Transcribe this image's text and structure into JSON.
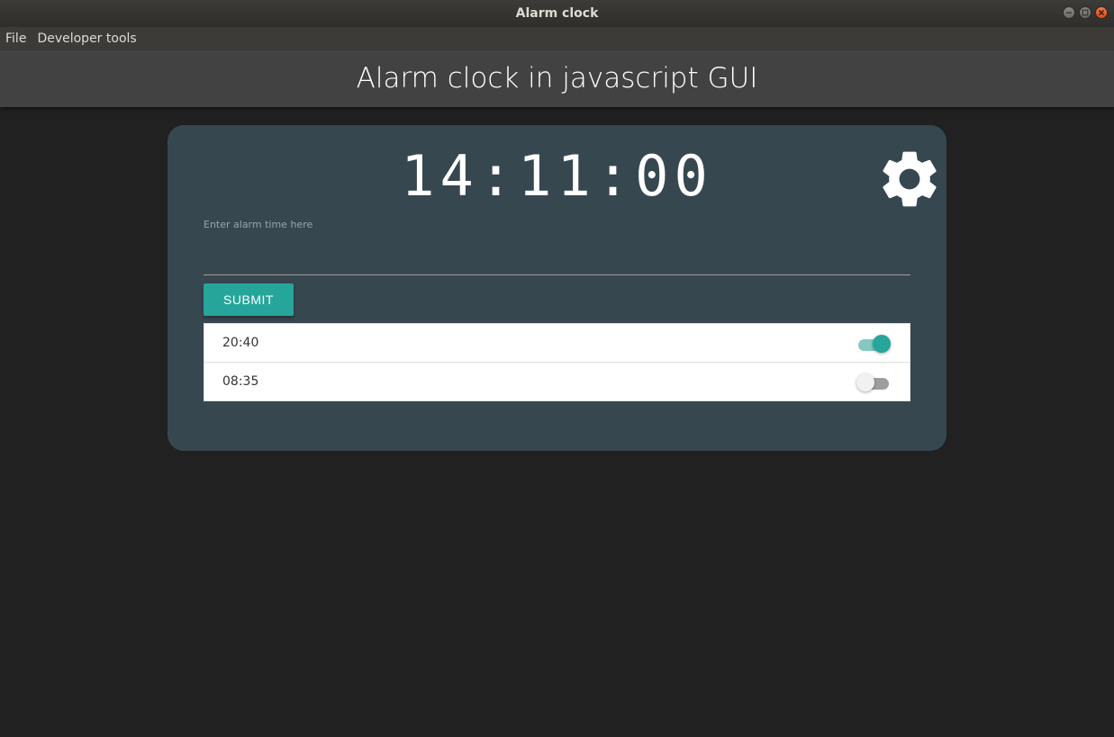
{
  "window": {
    "title": "Alarm clock",
    "buttons": [
      "minimize-icon",
      "maximize-icon",
      "close-icon"
    ]
  },
  "menu": {
    "items": [
      {
        "label": "File"
      },
      {
        "label": "Developer tools"
      }
    ]
  },
  "header": {
    "title": "Alarm clock in javascript GUI"
  },
  "clock": {
    "time": "14:11:00"
  },
  "settings": {
    "icon": "gear-icon"
  },
  "alarm_form": {
    "label": "Enter alarm time here",
    "value": "",
    "submit_label": "SUBMIT"
  },
  "alarms": [
    {
      "time": "20:40",
      "enabled": true
    },
    {
      "time": "08:35",
      "enabled": false
    }
  ],
  "colors": {
    "accent": "#26a69a",
    "card": "#37474f",
    "background": "#212121",
    "header": "#424242"
  }
}
